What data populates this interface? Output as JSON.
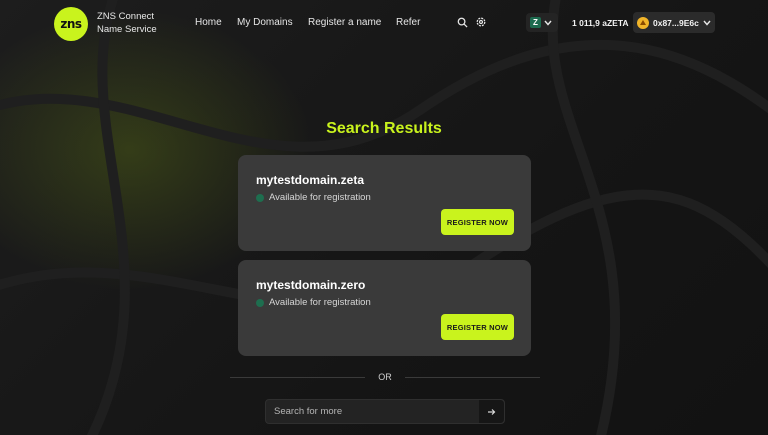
{
  "brand": {
    "logo_text": "zns",
    "name_line1": "ZNS Connect",
    "name_line2": "Name Service",
    "accent_color": "#c9f31d"
  },
  "nav": {
    "home": "Home",
    "my_domains": "My Domains",
    "register": "Register a name",
    "refer": "Refer"
  },
  "header_icons": {
    "search": "search-icon",
    "settings": "gear-icon"
  },
  "network": {
    "badge": "Z",
    "icon": "chevron-down-icon"
  },
  "wallet": {
    "balance": "1 011,9 aZETA",
    "address": "0x87...9E6c"
  },
  "page": {
    "title": "Search Results"
  },
  "results": [
    {
      "domain": "mytestdomain.zeta",
      "status": "Available for registration",
      "button": "REGISTER NOW"
    },
    {
      "domain": "mytestdomain.zero",
      "status": "Available for registration",
      "button": "REGISTER NOW"
    }
  ],
  "divider": {
    "label": "OR"
  },
  "search": {
    "placeholder": "Search for more",
    "submit_icon": "arrow-right-icon"
  }
}
